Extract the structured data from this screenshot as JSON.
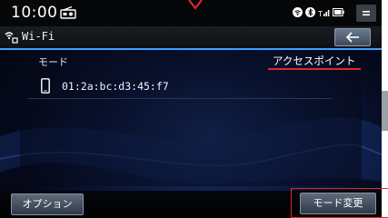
{
  "statusbar": {
    "time": "10:00",
    "icons": [
      "radio-icon",
      "wifi-icon",
      "bluetooth-icon",
      "signal-icon",
      "battery-icon",
      "menu-icon"
    ]
  },
  "header": {
    "title": "Wi-Fi",
    "title_icon": "wifi-icon",
    "back_icon": "back-arrow-icon"
  },
  "list": {
    "mode_label": "モード",
    "mode_value": "アクセスポイント",
    "devices": [
      {
        "icon": "smartphone-icon",
        "address": "01:2a:bc:d3:45:f7"
      }
    ]
  },
  "footer": {
    "options_label": "オプション",
    "mode_change_label": "モード変更"
  },
  "colors": {
    "accent_blue": "#3fa0ff",
    "highlight_red": "#e3262d"
  }
}
